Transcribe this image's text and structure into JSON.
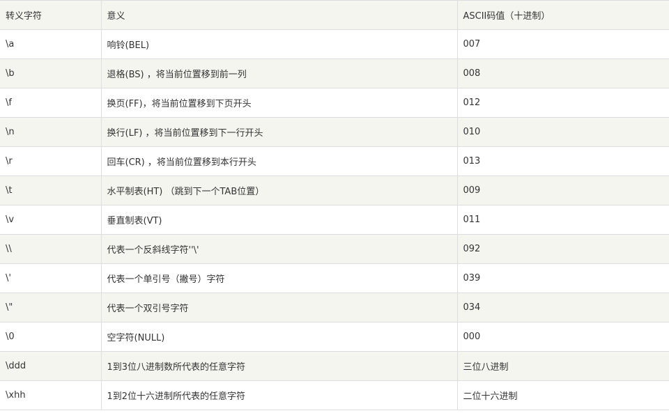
{
  "table": {
    "headers": [
      "转义字符",
      "意义",
      "ASCII码值（十进制）"
    ],
    "rows": [
      [
        "\\a",
        "响铃(BEL)",
        "007"
      ],
      [
        "\\b",
        "退格(BS) ，将当前位置移到前一列",
        "008"
      ],
      [
        "\\f",
        "换页(FF)，将当前位置移到下页开头",
        "012"
      ],
      [
        "\\n",
        "换行(LF) ，将当前位置移到下一行开头",
        "010"
      ],
      [
        "\\r",
        "回车(CR) ，将当前位置移到本行开头",
        "013"
      ],
      [
        "\\t",
        "水平制表(HT) （跳到下一个TAB位置）",
        "009"
      ],
      [
        "\\v",
        "垂直制表(VT)",
        "011"
      ],
      [
        "\\\\",
        "代表一个反斜线字符''\\'",
        "092"
      ],
      [
        "\\'",
        "代表一个单引号（撇号）字符",
        "039"
      ],
      [
        "\\\"",
        "代表一个双引号字符",
        "034"
      ],
      [
        "\\0",
        "空字符(NULL)",
        "000"
      ],
      [
        "\\ddd",
        "1到3位八进制数所代表的任意字符",
        "三位八进制"
      ],
      [
        "\\xhh",
        "1到2位十六进制所代表的任意字符",
        "二位十六进制"
      ]
    ]
  }
}
